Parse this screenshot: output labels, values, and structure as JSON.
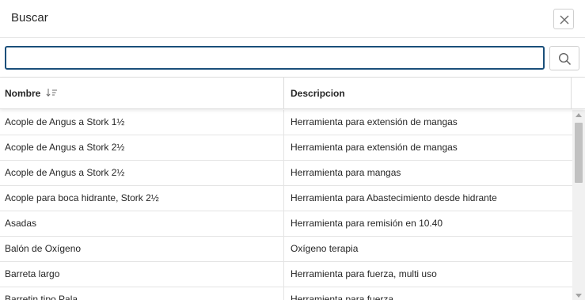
{
  "dialog": {
    "title": "Buscar",
    "close_icon": "close-icon"
  },
  "search": {
    "value": "",
    "placeholder": "",
    "button_icon": "search-icon"
  },
  "grid": {
    "columns": [
      {
        "label": "Nombre",
        "sorted": "descending",
        "icon": "sort-descending-icon"
      },
      {
        "label": "Descripcion"
      }
    ],
    "rows": [
      {
        "name": "Acople de Angus a Stork 1½",
        "description": "Herramienta para extensión de mangas"
      },
      {
        "name": "Acople de Angus a Stork 2½",
        "description": "Herramienta para extensión de mangas"
      },
      {
        "name": "Acople de Angus a Stork 2½",
        "description": "Herramienta para mangas"
      },
      {
        "name": "Acople para boca hidrante, Stork 2½",
        "description": "Herramienta para Abastecimiento desde hidrante"
      },
      {
        "name": "Asadas",
        "description": "Herramienta para remisión en 10.40"
      },
      {
        "name": "Balón de Oxígeno",
        "description": "Oxígeno terapia"
      },
      {
        "name": "Barreta largo",
        "description": "Herramienta para fuerza, multi uso"
      },
      {
        "name": "Barretin tipo Pala",
        "description": "Herramienta para fuerza"
      }
    ]
  },
  "colors": {
    "input_border": "#1a4f7a",
    "text": "#262626",
    "row_divider": "#e4e4e4",
    "scrollbar_thumb": "#c1c1c1"
  }
}
